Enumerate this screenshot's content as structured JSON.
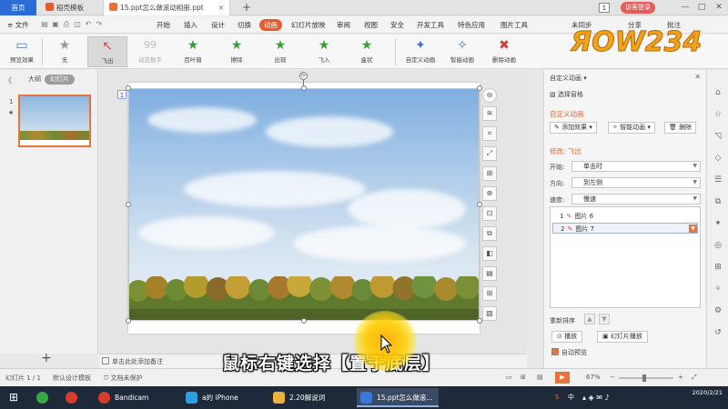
{
  "tabs": {
    "home": "首页",
    "template": "稻壳模板",
    "doc": "15.ppt怎么做滚动相册.ppt",
    "new_tab": "+"
  },
  "window": {
    "count": "1",
    "login": "访客登录",
    "minimize": "—",
    "maximize": "□",
    "close": "✕"
  },
  "menu": {
    "file": "≡ 文件",
    "items": [
      "开始",
      "插入",
      "设计",
      "切换",
      "动画",
      "幻灯片放映",
      "审阅",
      "视图",
      "安全",
      "开发工具",
      "特色应用",
      "图片工具"
    ],
    "active": "动画",
    "right": [
      "未同步",
      "分享",
      "批注"
    ]
  },
  "ribbon": {
    "preview": "预览效果",
    "effects": [
      {
        "label": "无",
        "glyph": "★"
      },
      {
        "label": "飞出",
        "glyph": "↖"
      },
      {
        "label": "动态数字",
        "glyph": "99"
      },
      {
        "label": "百叶窗",
        "glyph": "★"
      },
      {
        "label": "擦除",
        "glyph": "★"
      },
      {
        "label": "出现",
        "glyph": "★"
      },
      {
        "label": "飞入",
        "glyph": "★"
      },
      {
        "label": "盒状",
        "glyph": "★"
      }
    ],
    "custom_animation": "自定义动画",
    "smart_animation": "智能动画",
    "delete_animation": "删除动画"
  },
  "leftpane": {
    "outline": "大纲",
    "slides": "幻灯片",
    "collapse": "《",
    "thumb_number": "1",
    "thumb_star": "★",
    "add": "+"
  },
  "canvas": {
    "slide_number": "1",
    "notes_placeholder": "单击此处添加备注",
    "rotate": "⟳"
  },
  "floatbar": [
    "⊖",
    "≋",
    "⌗",
    "⤢",
    "⊞",
    "⊕",
    "⊡",
    "⧉",
    "◧",
    "▤",
    "⊞",
    "▨"
  ],
  "taskpane": {
    "title": "自定义动画 ▾",
    "close": "✕",
    "select_pane": "选择窗格",
    "custom_header": "自定义动画",
    "add_effect": "添加效果 ▾",
    "smart_animation": "智能动画 ▾",
    "delete": "删除",
    "modify": "修改: 飞出",
    "start_label": "开始:",
    "start_value": "单击时",
    "direction_label": "方向:",
    "direction_value": "到左侧",
    "speed_label": "速度:",
    "speed_value": "慢速",
    "list": [
      {
        "num": "1",
        "name": "图片 6"
      },
      {
        "num": "2",
        "name": "图片 7"
      }
    ],
    "reorder": "重新排序",
    "play": "播放",
    "slideshow": "幻灯片播放",
    "autopreview": "自动预览"
  },
  "status": {
    "slide": "幻灯片 1 / 1",
    "template": "默认设计模板",
    "doc_protect": "文档未保护",
    "zoom": "67%"
  },
  "caption": "鼠标右键选择【置于底层】",
  "watermark": "ЯOW234",
  "taskbar": {
    "apps": [
      {
        "label": "Bandicam",
        "color": "#d83b2f"
      },
      {
        "label": "a的 iPhone",
        "color": "#2aa0e0"
      },
      {
        "label": "2.20解说词",
        "color": "#e8b33a"
      },
      {
        "label": "15.ppt怎么做滚...",
        "color": "#3b78d8"
      }
    ],
    "time": "2020/2/21"
  }
}
